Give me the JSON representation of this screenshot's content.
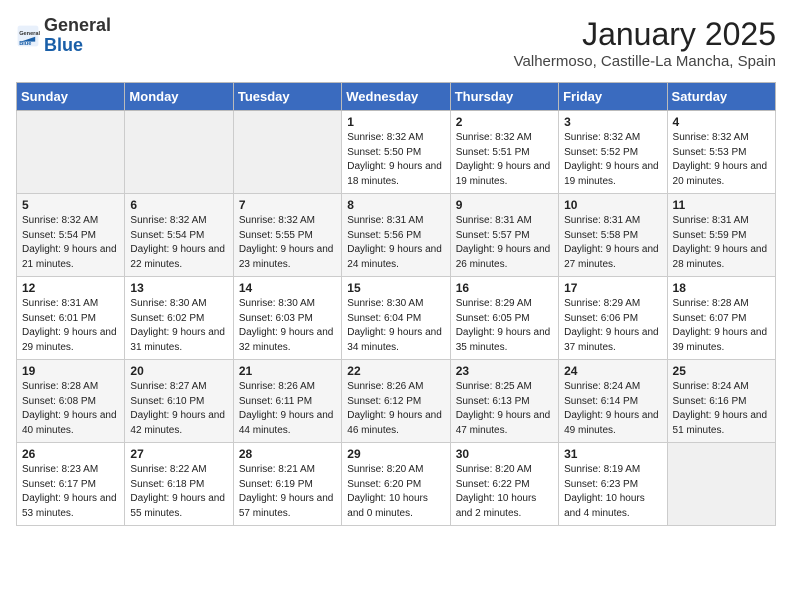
{
  "header": {
    "logo_general": "General",
    "logo_blue": "Blue",
    "month": "January 2025",
    "location": "Valhermoso, Castille-La Mancha, Spain"
  },
  "days_of_week": [
    "Sunday",
    "Monday",
    "Tuesday",
    "Wednesday",
    "Thursday",
    "Friday",
    "Saturday"
  ],
  "weeks": [
    [
      {
        "day": "",
        "empty": true
      },
      {
        "day": "",
        "empty": true
      },
      {
        "day": "",
        "empty": true
      },
      {
        "day": "1",
        "sunrise": "8:32 AM",
        "sunset": "5:50 PM",
        "daylight": "9 hours and 18 minutes."
      },
      {
        "day": "2",
        "sunrise": "8:32 AM",
        "sunset": "5:51 PM",
        "daylight": "9 hours and 19 minutes."
      },
      {
        "day": "3",
        "sunrise": "8:32 AM",
        "sunset": "5:52 PM",
        "daylight": "9 hours and 19 minutes."
      },
      {
        "day": "4",
        "sunrise": "8:32 AM",
        "sunset": "5:53 PM",
        "daylight": "9 hours and 20 minutes."
      }
    ],
    [
      {
        "day": "5",
        "sunrise": "8:32 AM",
        "sunset": "5:54 PM",
        "daylight": "9 hours and 21 minutes."
      },
      {
        "day": "6",
        "sunrise": "8:32 AM",
        "sunset": "5:54 PM",
        "daylight": "9 hours and 22 minutes."
      },
      {
        "day": "7",
        "sunrise": "8:32 AM",
        "sunset": "5:55 PM",
        "daylight": "9 hours and 23 minutes."
      },
      {
        "day": "8",
        "sunrise": "8:31 AM",
        "sunset": "5:56 PM",
        "daylight": "9 hours and 24 minutes."
      },
      {
        "day": "9",
        "sunrise": "8:31 AM",
        "sunset": "5:57 PM",
        "daylight": "9 hours and 26 minutes."
      },
      {
        "day": "10",
        "sunrise": "8:31 AM",
        "sunset": "5:58 PM",
        "daylight": "9 hours and 27 minutes."
      },
      {
        "day": "11",
        "sunrise": "8:31 AM",
        "sunset": "5:59 PM",
        "daylight": "9 hours and 28 minutes."
      }
    ],
    [
      {
        "day": "12",
        "sunrise": "8:31 AM",
        "sunset": "6:01 PM",
        "daylight": "9 hours and 29 minutes."
      },
      {
        "day": "13",
        "sunrise": "8:30 AM",
        "sunset": "6:02 PM",
        "daylight": "9 hours and 31 minutes."
      },
      {
        "day": "14",
        "sunrise": "8:30 AM",
        "sunset": "6:03 PM",
        "daylight": "9 hours and 32 minutes."
      },
      {
        "day": "15",
        "sunrise": "8:30 AM",
        "sunset": "6:04 PM",
        "daylight": "9 hours and 34 minutes."
      },
      {
        "day": "16",
        "sunrise": "8:29 AM",
        "sunset": "6:05 PM",
        "daylight": "9 hours and 35 minutes."
      },
      {
        "day": "17",
        "sunrise": "8:29 AM",
        "sunset": "6:06 PM",
        "daylight": "9 hours and 37 minutes."
      },
      {
        "day": "18",
        "sunrise": "8:28 AM",
        "sunset": "6:07 PM",
        "daylight": "9 hours and 39 minutes."
      }
    ],
    [
      {
        "day": "19",
        "sunrise": "8:28 AM",
        "sunset": "6:08 PM",
        "daylight": "9 hours and 40 minutes."
      },
      {
        "day": "20",
        "sunrise": "8:27 AM",
        "sunset": "6:10 PM",
        "daylight": "9 hours and 42 minutes."
      },
      {
        "day": "21",
        "sunrise": "8:26 AM",
        "sunset": "6:11 PM",
        "daylight": "9 hours and 44 minutes."
      },
      {
        "day": "22",
        "sunrise": "8:26 AM",
        "sunset": "6:12 PM",
        "daylight": "9 hours and 46 minutes."
      },
      {
        "day": "23",
        "sunrise": "8:25 AM",
        "sunset": "6:13 PM",
        "daylight": "9 hours and 47 minutes."
      },
      {
        "day": "24",
        "sunrise": "8:24 AM",
        "sunset": "6:14 PM",
        "daylight": "9 hours and 49 minutes."
      },
      {
        "day": "25",
        "sunrise": "8:24 AM",
        "sunset": "6:16 PM",
        "daylight": "9 hours and 51 minutes."
      }
    ],
    [
      {
        "day": "26",
        "sunrise": "8:23 AM",
        "sunset": "6:17 PM",
        "daylight": "9 hours and 53 minutes."
      },
      {
        "day": "27",
        "sunrise": "8:22 AM",
        "sunset": "6:18 PM",
        "daylight": "9 hours and 55 minutes."
      },
      {
        "day": "28",
        "sunrise": "8:21 AM",
        "sunset": "6:19 PM",
        "daylight": "9 hours and 57 minutes."
      },
      {
        "day": "29",
        "sunrise": "8:20 AM",
        "sunset": "6:20 PM",
        "daylight": "10 hours and 0 minutes."
      },
      {
        "day": "30",
        "sunrise": "8:20 AM",
        "sunset": "6:22 PM",
        "daylight": "10 hours and 2 minutes."
      },
      {
        "day": "31",
        "sunrise": "8:19 AM",
        "sunset": "6:23 PM",
        "daylight": "10 hours and 4 minutes."
      },
      {
        "day": "",
        "empty": true
      }
    ]
  ]
}
